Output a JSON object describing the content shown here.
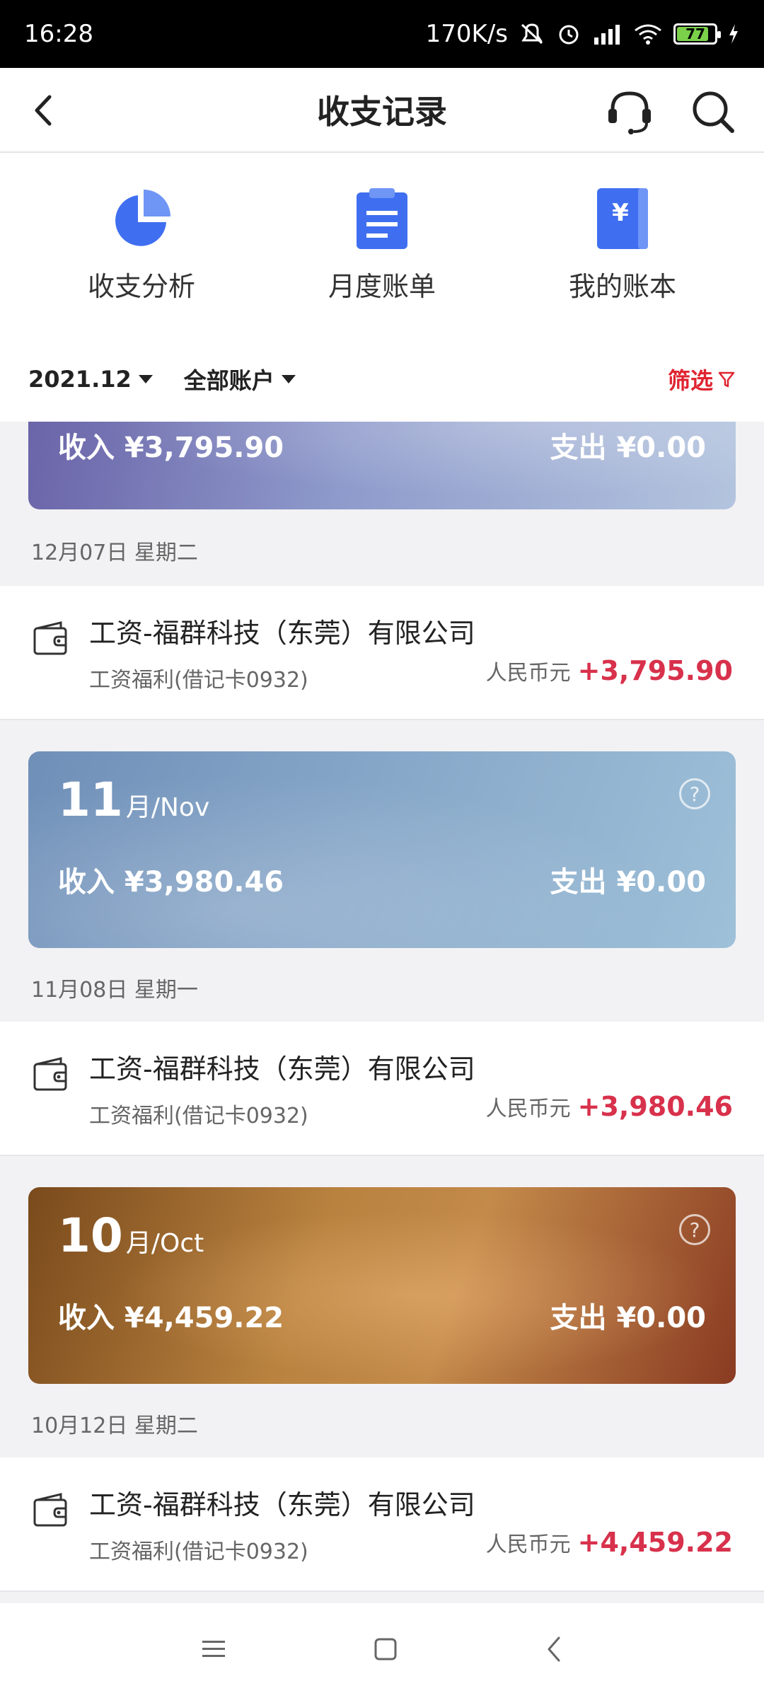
{
  "status": {
    "time": "16:28",
    "speed": "170K/s",
    "battery": "77"
  },
  "appbar": {
    "title": "收支记录"
  },
  "quick": [
    {
      "label": "收支分析",
      "icon": "pie-chart-icon"
    },
    {
      "label": "月度账单",
      "icon": "clipboard-icon"
    },
    {
      "label": "我的账本",
      "icon": "ledger-book-icon"
    }
  ],
  "filter": {
    "period": "2021.12",
    "account": "全部账户",
    "select_label": "筛选"
  },
  "months": [
    {
      "income": "收入 ¥3,795.90",
      "expense": "支出 ¥0.00",
      "date": "12月07日 星期二",
      "tx": {
        "name": "工资-福群科技（东莞）有限公司",
        "sub": "工资福利(借记卡0932)",
        "currency": "人民币元",
        "amount": "+3,795.90"
      }
    },
    {
      "num": "11",
      "suffix": "月/Nov",
      "income": "收入 ¥3,980.46",
      "expense": "支出 ¥0.00",
      "date": "11月08日 星期一",
      "tx": {
        "name": "工资-福群科技（东莞）有限公司",
        "sub": "工资福利(借记卡0932)",
        "currency": "人民币元",
        "amount": "+3,980.46"
      }
    },
    {
      "num": "10",
      "suffix": "月/Oct",
      "income": "收入 ¥4,459.22",
      "expense": "支出 ¥0.00",
      "date": "10月12日 星期二",
      "tx": {
        "name": "工资-福群科技（东莞）有限公司",
        "sub": "工资福利(借记卡0932)",
        "currency": "人民币元",
        "amount": "+4,459.22"
      }
    }
  ],
  "colors": {
    "accent_red": "#d8314c",
    "filter_red": "#e02430",
    "icon_blue": "#3f6ff0"
  }
}
